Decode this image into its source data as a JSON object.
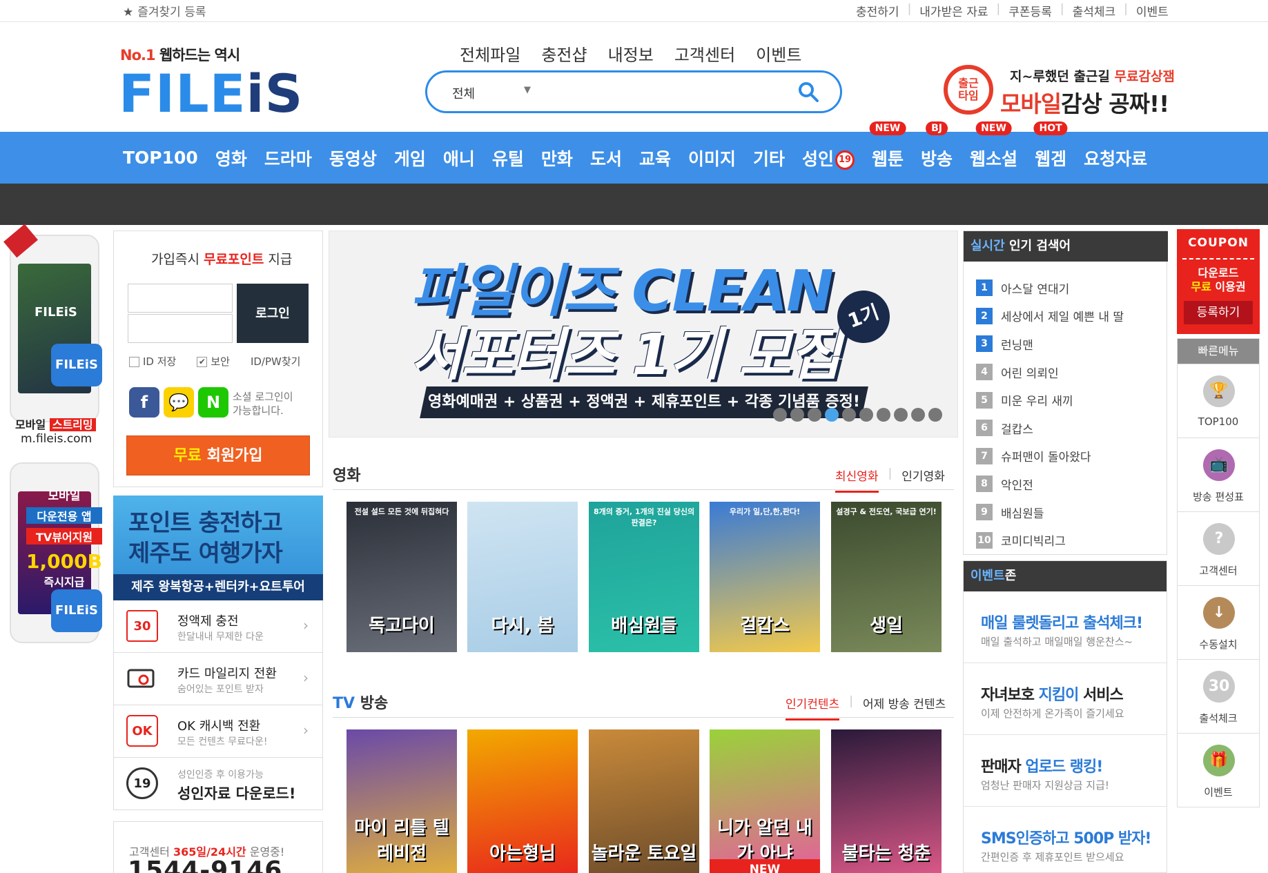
{
  "topbar": {
    "favorite": "즐겨찾기 등록",
    "links": [
      "충전하기",
      "내가받은 자료",
      "쿠폰등록",
      "출석체크",
      "이벤트"
    ]
  },
  "logo": {
    "tagline_no1": "No.1",
    "tagline": "웹하드는 역시",
    "name_a": "FILE",
    "name_i": "i",
    "name_s": "S"
  },
  "gnb": [
    "전체파일",
    "충전샵",
    "내정보",
    "고객센터",
    "이벤트"
  ],
  "search": {
    "scope": "전체",
    "placeholder": ""
  },
  "header_ad": {
    "line1_a": "지~루했던 출근길 ",
    "line1_b": "무료감상잼",
    "line2_a": "모바일",
    "line2_b": "감상 공짜!!",
    "clock": "출근\n타임"
  },
  "categories": [
    {
      "label": "TOP100",
      "badge": ""
    },
    {
      "label": "영화",
      "badge": ""
    },
    {
      "label": "드라마",
      "badge": ""
    },
    {
      "label": "동영상",
      "badge": ""
    },
    {
      "label": "게임",
      "badge": ""
    },
    {
      "label": "애니",
      "badge": ""
    },
    {
      "label": "유틸",
      "badge": ""
    },
    {
      "label": "만화",
      "badge": ""
    },
    {
      "label": "도서",
      "badge": ""
    },
    {
      "label": "교육",
      "badge": ""
    },
    {
      "label": "이미지",
      "badge": ""
    },
    {
      "label": "기타",
      "badge": ""
    },
    {
      "label": "성인",
      "badge": "",
      "age": "19"
    },
    {
      "label": "웹툰",
      "badge": "NEW"
    },
    {
      "label": "방송",
      "badge": "BJ"
    },
    {
      "label": "웹소설",
      "badge": "NEW"
    },
    {
      "label": "웹겜",
      "badge": "HOT"
    },
    {
      "label": "요청자료",
      "badge": ""
    }
  ],
  "mobile_ad1": {
    "logo": "FILEiS",
    "badge": "FILEiS",
    "label_a": "모바일 ",
    "label_b": "스트리밍",
    "url": "m.fileis.com"
  },
  "mobile_ad2": {
    "t1": "모바일",
    "t2": "다운전용 앱",
    "t3": "TV뷰어지원",
    "t4": "1,000B",
    "t5": "즉시지급",
    "badge": "FILEiS"
  },
  "login": {
    "title_a": "가입즉시 ",
    "title_b": "무료포인트",
    "title_c": " 지급",
    "login_button": "로그인",
    "save_id": "ID 저장",
    "secure": "보안",
    "find": "ID/PW찾기",
    "social_text_1": "소셜 로그인이",
    "social_text_2": "가능합니다.",
    "join_a": "무료",
    "join_b": " 회원가입"
  },
  "jeju": {
    "l1": "포인트 충전하고",
    "l2": "제주도 여행가자",
    "l3": "제주 왕복항공+렌터카+요트투어"
  },
  "services": [
    {
      "title": "정액제 충전",
      "sub": "한달내내 무제한 다운",
      "icon": "30"
    },
    {
      "title": "카드 마일리지 전환",
      "sub": "숨어있는 포인트 받자",
      "icon": "card"
    },
    {
      "title": "OK 캐시백 전환",
      "sub": "모든 컨텐츠 무료다운!",
      "icon": "OK"
    }
  ],
  "adult": {
    "small": "성인인증 후 이용가능",
    "big": "성인자료 다운로드!",
    "icon": "19"
  },
  "customer_center": {
    "l1_a": "고객센터 ",
    "l1_b": "365일/24시간",
    "l1_c": " 운영중!",
    "phone": "1544-9146"
  },
  "main_banner": {
    "l1": "파일이즈 CLEAN",
    "l2": "서포터즈 1기 모집",
    "badge": "1기",
    "bar": "영화예매권 + 상품권 + 정액권 + 제휴포인트 + 각종 기념품 증정!",
    "dots": 10,
    "active_dot": 3
  },
  "movies": {
    "title": "영화",
    "tabs": [
      "최신영화",
      "인기영화"
    ],
    "posters": [
      {
        "title": "독고다이",
        "top": "전설 설드 모든 것에 뒤집혀다",
        "colors": [
          "#2a2f38",
          "#6a6e78"
        ]
      },
      {
        "title": "다시, 봄",
        "top": "",
        "colors": [
          "#cfe4f2",
          "#a9cde6"
        ]
      },
      {
        "title": "배심원들",
        "top": "8개의 증거, 1개의 진실 당신의 판결은?",
        "colors": [
          "#1fa39b",
          "#2bc0a8"
        ]
      },
      {
        "title": "걸캅스",
        "top": "우리가 일,단,한,판다!",
        "colors": [
          "#3a7bd5",
          "#f2c94c"
        ]
      },
      {
        "title": "생일",
        "top": "설경구 & 전도연, 국보급 연기!",
        "colors": [
          "#3b4a2e",
          "#7a8a5a"
        ]
      }
    ]
  },
  "tv": {
    "title_a": "TV",
    "title_b": " 방송",
    "tabs": [
      "인기컨텐츠",
      "어제 방송 컨텐츠"
    ],
    "posters": [
      {
        "title": "마이 리틀 텔레비전",
        "colors": [
          "#6a4aa8",
          "#e4b23a"
        ],
        "new": ""
      },
      {
        "title": "아는형님",
        "colors": [
          "#f2a900",
          "#e8231d"
        ],
        "new": ""
      },
      {
        "title": "놀라운 토요일",
        "colors": [
          "#c98a3a",
          "#6a4a2a"
        ],
        "new": ""
      },
      {
        "title": "니가 알던 내가 아냐",
        "colors": [
          "#9ad23a",
          "#e85aa0"
        ],
        "new": "NEW"
      },
      {
        "title": "불타는 청춘",
        "colors": [
          "#2a1a3a",
          "#e05a8a"
        ],
        "new": ""
      }
    ]
  },
  "ranking": {
    "title_a": "실시간",
    "title_b": " 인기 검색어",
    "items": [
      "아스달 연대기",
      "세상에서 제일 예쁜 내 딸",
      "런닝맨",
      "어린 의뢰인",
      "미운 우리 새끼",
      "걸캅스",
      "슈퍼맨이 돌아왔다",
      "악인전",
      "배심원들",
      "코미디빅리그"
    ]
  },
  "events": {
    "title_a": "이벤트",
    "title_b": "존",
    "items": [
      {
        "a": "매일 룰렛돌리고 출석체크!",
        "b": "",
        "sub": "매일 출석하고 매일매일 행운찬스~",
        "style": "blue"
      },
      {
        "a": "자녀보호 ",
        "b": "지킴이",
        "c": " 서비스",
        "sub": "이제 안전하게 온가족이 즐기세요"
      },
      {
        "a": "판매자 ",
        "b": "업로드 랭킹!",
        "c": "",
        "sub": "엄청난 판매자 지원상금 지급!"
      },
      {
        "a": "SMS인증하고 500P 받자!",
        "b": "",
        "sub": "간편인증 후 제휴포인트 받으세요",
        "style": "blue"
      }
    ]
  },
  "coupon": {
    "title": "COUPON",
    "l1": "다운로드",
    "l2_a": "무료",
    "l2_b": " 이용권",
    "button": "등록하기"
  },
  "quick_menu": {
    "title": "빠른메뉴",
    "items": [
      {
        "label": "TOP100",
        "icon": "trophy-icon",
        "color": "#c9c9c9"
      },
      {
        "label": "방송 편성표",
        "icon": "tv-icon",
        "color": "#b06ab0"
      },
      {
        "label": "고객센터",
        "icon": "question-icon",
        "color": "#c9c9c9"
      },
      {
        "label": "수동설치",
        "icon": "download-icon",
        "color": "#b58a5a"
      },
      {
        "label": "출석체크",
        "icon": "calendar-icon",
        "color": "#c9c9c9"
      },
      {
        "label": "이벤트",
        "icon": "gift-icon",
        "color": "#8ab86a"
      }
    ]
  },
  "colors": {
    "brand_blue": "#3d8fe8",
    "accent_red": "#e8231d",
    "dark": "#3a3a3a",
    "join_orange": "#f06020"
  }
}
